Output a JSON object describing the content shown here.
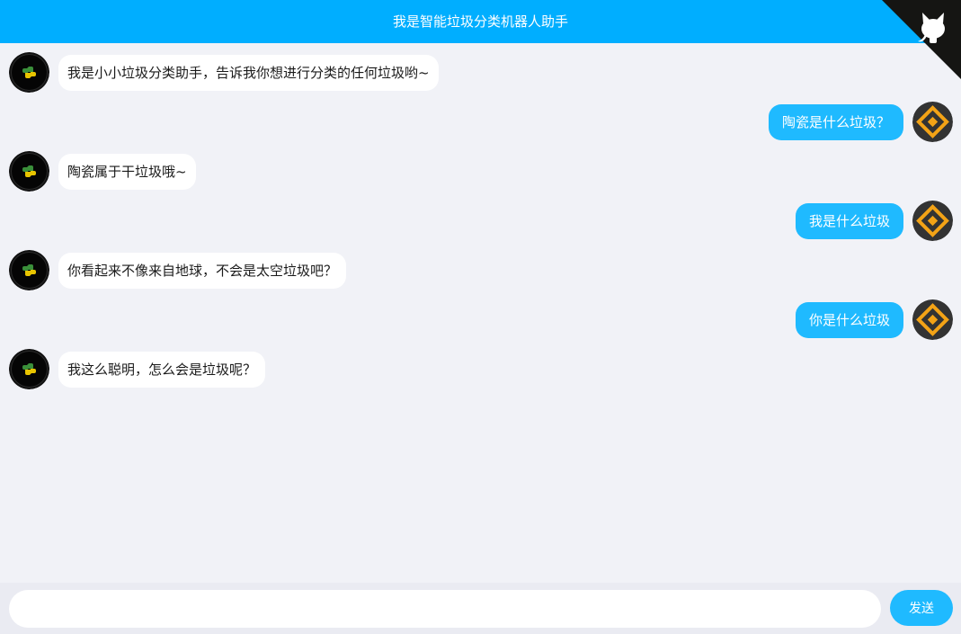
{
  "header": {
    "title": "我是智能垃圾分类机器人助手",
    "corner_icon": "github-cat-icon"
  },
  "messages": [
    {
      "role": "bot",
      "text": "我是小小垃圾分类助手，告诉我你想进行分类的任何垃圾哟~"
    },
    {
      "role": "user",
      "text": "陶瓷是什么垃圾？"
    },
    {
      "role": "bot",
      "text": "陶瓷属于干垃圾哦~"
    },
    {
      "role": "user",
      "text": "我是什么垃圾"
    },
    {
      "role": "bot",
      "text": "你看起来不像来自地球，不会是太空垃圾吧？"
    },
    {
      "role": "user",
      "text": "你是什么垃圾"
    },
    {
      "role": "bot",
      "text": "我这么聪明，怎么会是垃圾呢？"
    }
  ],
  "composer": {
    "placeholder": "",
    "send_label": "发送"
  },
  "colors": {
    "header": "#00aeff",
    "user_bubble": "#1fbaff",
    "bot_bubble": "#ffffff",
    "background": "#f1f2f7"
  }
}
